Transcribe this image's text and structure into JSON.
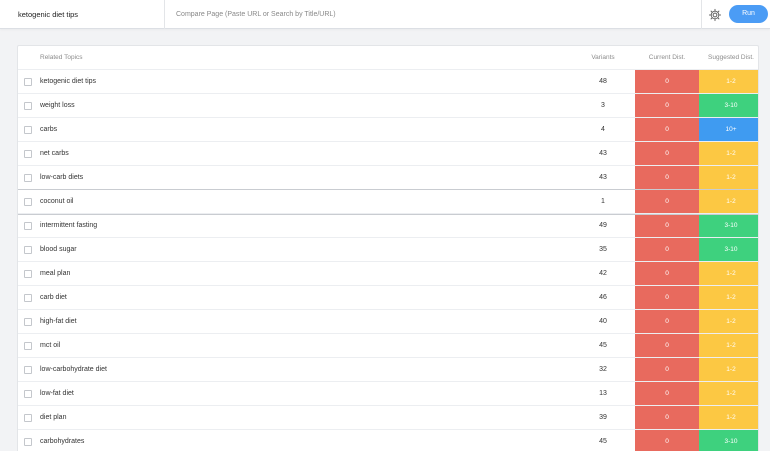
{
  "topbar": {
    "keyword": "ketogenic diet tips",
    "compare_placeholder": "Compare Page (Paste URL or Search by Title/URL)",
    "settings_icon": "gear-icon",
    "run_label": "Run",
    "accent": "#4b9cf5"
  },
  "table": {
    "headers": {
      "topic": "Related Topics",
      "variants": "Variants",
      "current": "Current Dist.",
      "suggested": "Suggested Dist."
    },
    "colors": {
      "current": "#e86a5e",
      "s1_2": "#fcc843",
      "s3_10": "#3ed17e",
      "s10_plus": "#3f9bf1"
    },
    "rows": [
      {
        "topic": "ketogenic diet tips",
        "variants": "48",
        "current": "0",
        "suggested": "1-2"
      },
      {
        "topic": "weight loss",
        "variants": "3",
        "current": "0",
        "suggested": "3-10"
      },
      {
        "topic": "carbs",
        "variants": "4",
        "current": "0",
        "suggested": "10+"
      },
      {
        "topic": "net carbs",
        "variants": "43",
        "current": "0",
        "suggested": "1-2"
      },
      {
        "topic": "low-carb diets",
        "variants": "43",
        "current": "0",
        "suggested": "1-2"
      },
      {
        "topic": "coconut oil",
        "variants": "1",
        "current": "0",
        "suggested": "1-2"
      },
      {
        "topic": "intermittent fasting",
        "variants": "49",
        "current": "0",
        "suggested": "3-10"
      },
      {
        "topic": "blood sugar",
        "variants": "35",
        "current": "0",
        "suggested": "3-10"
      },
      {
        "topic": "meal plan",
        "variants": "42",
        "current": "0",
        "suggested": "1-2"
      },
      {
        "topic": "carb diet",
        "variants": "46",
        "current": "0",
        "suggested": "1-2"
      },
      {
        "topic": "high-fat diet",
        "variants": "40",
        "current": "0",
        "suggested": "1-2"
      },
      {
        "topic": "mct oil",
        "variants": "45",
        "current": "0",
        "suggested": "1-2"
      },
      {
        "topic": "low-carbohydrate diet",
        "variants": "32",
        "current": "0",
        "suggested": "1-2"
      },
      {
        "topic": "low-fat diet",
        "variants": "13",
        "current": "0",
        "suggested": "1-2"
      },
      {
        "topic": "diet plan",
        "variants": "39",
        "current": "0",
        "suggested": "1-2"
      },
      {
        "topic": "carbohydrates",
        "variants": "45",
        "current": "0",
        "suggested": "3-10"
      }
    ]
  }
}
